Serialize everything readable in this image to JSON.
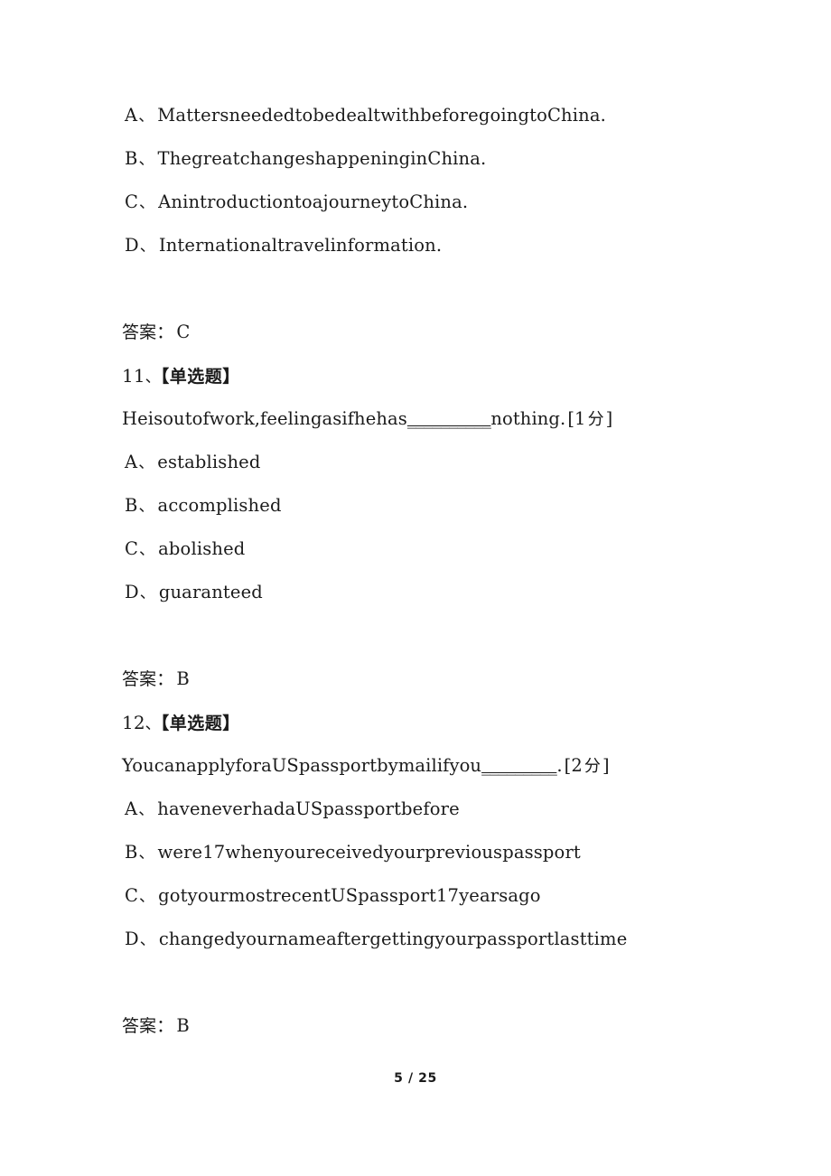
{
  "document": {
    "background_color": "#ffffff",
    "text_color": "#1b1b1b"
  },
  "blocks": [
    {
      "kind": "options",
      "options": [
        {
          "letter": "A",
          "sep": "、",
          "text": "Mattersneededtobedealtwithbeforegoingto China."
        },
        {
          "letter": "B",
          "sep": "、",
          "text": "ThegreatchangeshappeninginChina."
        },
        {
          "letter": "C",
          "sep": "、",
          "text": "AnintroductiontoajourneytoChina."
        },
        {
          "letter": "D",
          "sep": "、",
          "text": "Internationaltravelinformation."
        }
      ]
    }
  ],
  "q10_options": [
    {
      "letter": "A",
      "sep": "、",
      "text": "MattersneededtobedealtwithbeforegoingtoChina."
    },
    {
      "letter": "B",
      "sep": "、",
      "text": "ThegreatchangeshappeninginChina."
    },
    {
      "letter": "C",
      "sep": "、",
      "text": "AnintroductiontoajourneytoChina."
    },
    {
      "letter": "D",
      "sep": "、",
      "text": "Internationaltravelinformation."
    }
  ],
  "answer10": {
    "label": "答案：",
    "value": "C"
  },
  "question11": {
    "number": "11",
    "sep": "、",
    "type": "【单选题】",
    "stem_before": "Heisoutofwork,feelingasifhehas",
    "blank": "__________",
    "stem_after": "nothing.",
    "points_open": "[",
    "points_value": "1",
    "points_unit": "分",
    "points_close": "]",
    "options": [
      {
        "letter": "A",
        "sep": "、",
        "text": "established"
      },
      {
        "letter": "B",
        "sep": "、",
        "text": "accomplished"
      },
      {
        "letter": "C",
        "sep": "、",
        "text": "abolished"
      },
      {
        "letter": "D",
        "sep": "、",
        "text": "guaranteed"
      }
    ],
    "answer": {
      "label": "答案：",
      "value": "B"
    }
  },
  "question12": {
    "number": "12",
    "sep": "、",
    "type": "【单选题】",
    "stem_before": "YoucanapplyforaUSpassportbymailifyou",
    "blank": "_________",
    "stem_after": ".",
    "points_open": "[",
    "points_value": "2",
    "points_unit": "分",
    "points_close": "]",
    "options": [
      {
        "letter": "A",
        "sep": "、",
        "text": "haveneverhadaUSpassportbefore"
      },
      {
        "letter": "B",
        "sep": "、",
        "text": "were17whenyoureceivedyourpreviouspassport"
      },
      {
        "letter": "C",
        "sep": "、",
        "text": "gotyourmostrecentUSpassport17yearsago"
      },
      {
        "letter": "D",
        "sep": "、",
        "text": "changedyournameaftergettingyourpassportlasttime"
      }
    ],
    "answer": {
      "label": "答案：",
      "value": "B"
    }
  },
  "footer": {
    "page_label": "5 / 25",
    "current_page": "5",
    "total_pages": "25"
  }
}
